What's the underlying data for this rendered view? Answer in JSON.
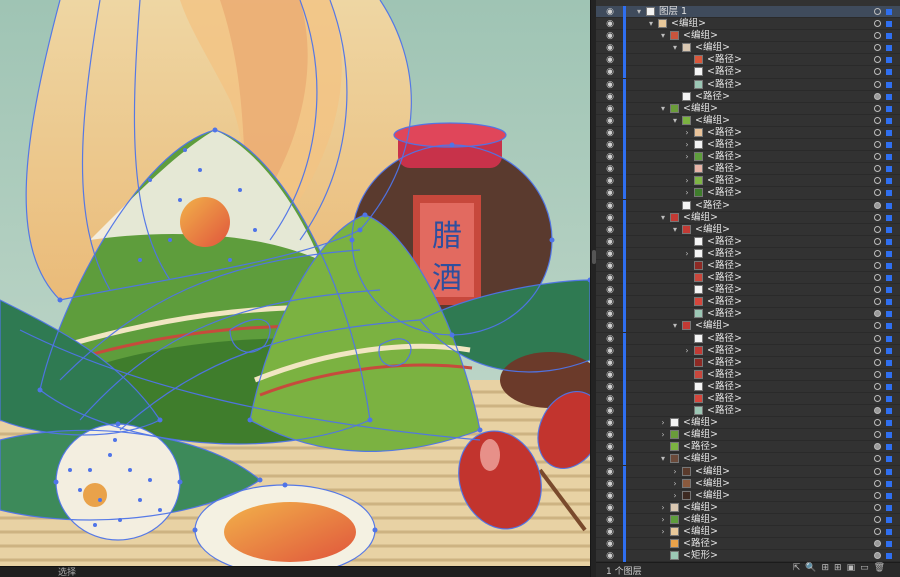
{
  "canvas": {
    "jar_label_chars": [
      "腊",
      "酒"
    ],
    "status_text": "选择"
  },
  "layers_panel": {
    "rows": [
      {
        "label": "图层 1",
        "depth": 0,
        "twirl": "down",
        "selected": true,
        "thumb": "#f2f2f2",
        "target_on": false
      },
      {
        "label": "<编组>",
        "depth": 1,
        "twirl": "down",
        "thumb": "#e8c89a"
      },
      {
        "label": "<编组>",
        "depth": 2,
        "twirl": "down",
        "thumb": "#c8553d"
      },
      {
        "label": "<编组>",
        "depth": 3,
        "twirl": "down",
        "thumb": "#d9c7b1"
      },
      {
        "label": "<路径>",
        "depth": 4,
        "twirl": "",
        "thumb": "#d9573b"
      },
      {
        "label": "<路径>",
        "depth": 4,
        "twirl": "",
        "thumb": "#f4f4f4"
      },
      {
        "label": "<路径>",
        "depth": 4,
        "twirl": "",
        "thumb": "#9cc7b5"
      },
      {
        "label": "<路径>",
        "depth": 3,
        "twirl": "",
        "thumb": "#f4f4f4",
        "target_on": true
      },
      {
        "label": "<编组>",
        "depth": 2,
        "twirl": "down",
        "thumb": "#6a9c3a"
      },
      {
        "label": "<编组>",
        "depth": 3,
        "twirl": "down",
        "thumb": "#7bb241"
      },
      {
        "label": "<路径>",
        "depth": 4,
        "twirl": "right",
        "thumb": "#e9c39a"
      },
      {
        "label": "<路径>",
        "depth": 4,
        "twirl": "right",
        "thumb": "#f4f4f4"
      },
      {
        "label": "<路径>",
        "depth": 4,
        "twirl": "right",
        "thumb": "#5e9d3c"
      },
      {
        "label": "<路径>",
        "depth": 4,
        "twirl": "",
        "thumb": "#e8b4a8"
      },
      {
        "label": "<路径>",
        "depth": 4,
        "twirl": "right",
        "thumb": "#7fb546"
      },
      {
        "label": "<路径>",
        "depth": 4,
        "twirl": "right",
        "thumb": "#3f7d2c"
      },
      {
        "label": "<路径>",
        "depth": 3,
        "twirl": "",
        "thumb": "#f4f4f4",
        "target_on": true
      },
      {
        "label": "<编组>",
        "depth": 2,
        "twirl": "down",
        "thumb": "#c23a34"
      },
      {
        "label": "<编组>",
        "depth": 3,
        "twirl": "down",
        "thumb": "#c23a34"
      },
      {
        "label": "<路径>",
        "depth": 4,
        "twirl": "",
        "thumb": "#f4f4f4"
      },
      {
        "label": "<路径>",
        "depth": 4,
        "twirl": "right",
        "thumb": "#f4f4f4"
      },
      {
        "label": "<路径>",
        "depth": 4,
        "twirl": "",
        "thumb": "#8e2a24"
      },
      {
        "label": "<路径>",
        "depth": 4,
        "twirl": "",
        "thumb": "#c9473c"
      },
      {
        "label": "<路径>",
        "depth": 4,
        "twirl": "",
        "thumb": "#f4f4f4"
      },
      {
        "label": "<路径>",
        "depth": 4,
        "twirl": "",
        "thumb": "#d5463c"
      },
      {
        "label": "<路径>",
        "depth": 4,
        "twirl": "",
        "thumb": "#9cc7b5",
        "target_on": true
      },
      {
        "label": "<编组>",
        "depth": 3,
        "twirl": "down",
        "thumb": "#c23a34"
      },
      {
        "label": "<路径>",
        "depth": 4,
        "twirl": "",
        "thumb": "#f4f4f4"
      },
      {
        "label": "<路径>",
        "depth": 4,
        "twirl": "right",
        "thumb": "#c23a34"
      },
      {
        "label": "<路径>",
        "depth": 4,
        "twirl": "",
        "thumb": "#8e2a24"
      },
      {
        "label": "<路径>",
        "depth": 4,
        "twirl": "",
        "thumb": "#c9473c"
      },
      {
        "label": "<路径>",
        "depth": 4,
        "twirl": "",
        "thumb": "#f4f4f4"
      },
      {
        "label": "<路径>",
        "depth": 4,
        "twirl": "",
        "thumb": "#d5463c"
      },
      {
        "label": "<路径>",
        "depth": 4,
        "twirl": "",
        "thumb": "#9cc7b5",
        "target_on": true
      },
      {
        "label": "<编组>",
        "depth": 2,
        "twirl": "right",
        "thumb": "#f4f4f4"
      },
      {
        "label": "<编组>",
        "depth": 2,
        "twirl": "right",
        "thumb": "#6a9c3a"
      },
      {
        "label": "<路径>",
        "depth": 2,
        "twirl": "",
        "thumb": "#7bb241",
        "target_on": true
      },
      {
        "label": "<编组>",
        "depth": 2,
        "twirl": "down",
        "thumb": "#6b4a3a"
      },
      {
        "label": "<编组>",
        "depth": 3,
        "twirl": "right",
        "thumb": "#5b3b2c"
      },
      {
        "label": "<编组>",
        "depth": 3,
        "twirl": "right",
        "thumb": "#8a5a3e"
      },
      {
        "label": "<编组>",
        "depth": 3,
        "twirl": "right",
        "thumb": "#3d2a22"
      },
      {
        "label": "<编组>",
        "depth": 2,
        "twirl": "right",
        "thumb": "#d9c7b1"
      },
      {
        "label": "<编组>",
        "depth": 2,
        "twirl": "right",
        "thumb": "#5e9d3c"
      },
      {
        "label": "<编组>",
        "depth": 2,
        "twirl": "right",
        "thumb": "#e8c89a"
      },
      {
        "label": "<路径>",
        "depth": 2,
        "twirl": "",
        "thumb": "#e9a24a",
        "target_on": true
      },
      {
        "label": "<矩形>",
        "depth": 2,
        "twirl": "",
        "thumb": "#9cc7b5",
        "target_on": true
      }
    ],
    "footer_count": "1 个图层"
  }
}
